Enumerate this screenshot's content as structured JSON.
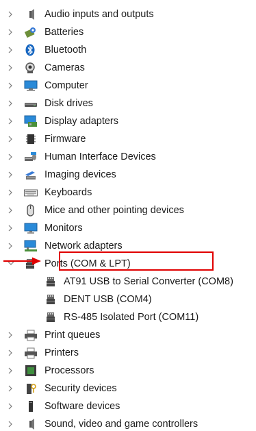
{
  "tree": {
    "items": [
      {
        "label": "Audio inputs and outputs",
        "icon": "speaker-icon",
        "expanded": false
      },
      {
        "label": "Batteries",
        "icon": "battery-icon",
        "expanded": false
      },
      {
        "label": "Bluetooth",
        "icon": "bluetooth-icon",
        "expanded": false
      },
      {
        "label": "Cameras",
        "icon": "camera-icon",
        "expanded": false
      },
      {
        "label": "Computer",
        "icon": "computer-icon",
        "expanded": false
      },
      {
        "label": "Disk drives",
        "icon": "disk-drive-icon",
        "expanded": false
      },
      {
        "label": "Display adapters",
        "icon": "display-adapter-icon",
        "expanded": false
      },
      {
        "label": "Firmware",
        "icon": "firmware-icon",
        "expanded": false
      },
      {
        "label": "Human Interface Devices",
        "icon": "hid-icon",
        "expanded": false
      },
      {
        "label": "Imaging devices",
        "icon": "imaging-icon",
        "expanded": false
      },
      {
        "label": "Keyboards",
        "icon": "keyboard-icon",
        "expanded": false
      },
      {
        "label": "Mice and other pointing devices",
        "icon": "mouse-icon",
        "expanded": false
      },
      {
        "label": "Monitors",
        "icon": "monitor-icon",
        "expanded": false
      },
      {
        "label": "Network adapters",
        "icon": "network-adapter-icon",
        "expanded": false
      },
      {
        "label": "Ports (COM & LPT)",
        "icon": "port-icon",
        "expanded": true,
        "children": [
          {
            "label": "AT91 USB to Serial Converter (COM8)",
            "icon": "port-icon",
            "highlighted": true
          },
          {
            "label": "DENT USB (COM4)",
            "icon": "port-icon"
          },
          {
            "label": "RS-485 Isolated Port (COM11)",
            "icon": "port-icon"
          }
        ]
      },
      {
        "label": "Print queues",
        "icon": "printer-icon",
        "expanded": false
      },
      {
        "label": "Printers",
        "icon": "printer-icon",
        "expanded": false
      },
      {
        "label": "Processors",
        "icon": "processor-icon",
        "expanded": false
      },
      {
        "label": "Security devices",
        "icon": "security-icon",
        "expanded": false
      },
      {
        "label": "Software devices",
        "icon": "software-device-icon",
        "expanded": false
      },
      {
        "label": "Sound, video and game controllers",
        "icon": "speaker-icon",
        "expanded": false
      }
    ]
  },
  "colors": {
    "highlight": "#e00000",
    "chevron": "#7a7a7a",
    "text": "#1b1b1b"
  }
}
